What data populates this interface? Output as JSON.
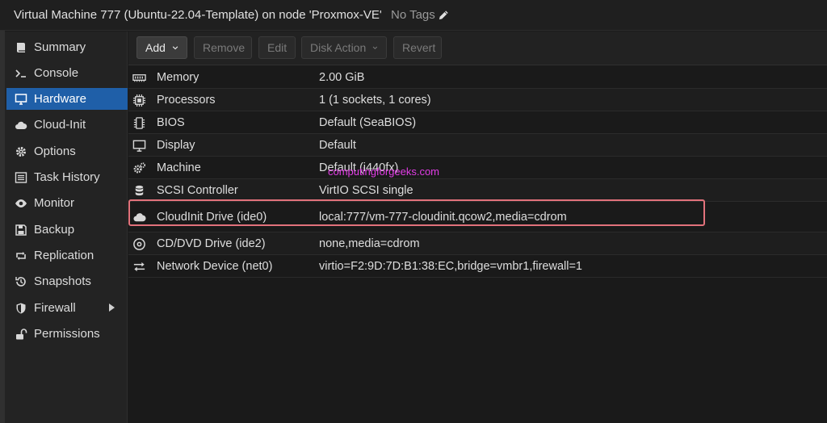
{
  "header": {
    "title": "Virtual Machine 777 (Ubuntu-22.04-Template) on node 'Proxmox-VE'",
    "tags_label": "No Tags",
    "tags_icon": "pencil-icon"
  },
  "sidebar": {
    "items": [
      {
        "label": "Summary",
        "icon": "book-icon",
        "active": false
      },
      {
        "label": "Console",
        "icon": "terminal-icon",
        "active": false
      },
      {
        "label": "Hardware",
        "icon": "desktop-icon",
        "active": true
      },
      {
        "label": "Cloud-Init",
        "icon": "cloud-icon",
        "active": false
      },
      {
        "label": "Options",
        "icon": "gear-icon",
        "active": false
      },
      {
        "label": "Task History",
        "icon": "list-icon",
        "active": false
      },
      {
        "label": "Monitor",
        "icon": "eye-icon",
        "active": false
      },
      {
        "label": "Backup",
        "icon": "floppy-icon",
        "active": false
      },
      {
        "label": "Replication",
        "icon": "retweet-icon",
        "active": false
      },
      {
        "label": "Snapshots",
        "icon": "history-icon",
        "active": false
      },
      {
        "label": "Firewall",
        "icon": "shield-icon",
        "active": false,
        "expandable": true
      },
      {
        "label": "Permissions",
        "icon": "unlock-icon",
        "active": false
      }
    ]
  },
  "toolbar": {
    "add": "Add",
    "remove": "Remove",
    "edit": "Edit",
    "disk_action": "Disk Action",
    "revert": "Revert"
  },
  "hardware": {
    "rows": [
      {
        "name": "Memory",
        "value": "2.00 GiB",
        "icon": "memory-icon"
      },
      {
        "name": "Processors",
        "value": "1 (1 sockets, 1 cores)",
        "icon": "cpu-icon"
      },
      {
        "name": "BIOS",
        "value": "Default (SeaBIOS)",
        "icon": "microchip-icon"
      },
      {
        "name": "Display",
        "value": "Default",
        "icon": "desktop-icon"
      },
      {
        "name": "Machine",
        "value": "Default (i440fx)",
        "icon": "cogs-icon"
      },
      {
        "name": "SCSI Controller",
        "value": "VirtIO SCSI single",
        "icon": "database-icon"
      },
      {
        "name": "CloudInit Drive (ide0)",
        "value": "local:777/vm-777-cloudinit.qcow2,media=cdrom",
        "icon": "cloud-icon",
        "highlighted": true
      },
      {
        "name": "CD/DVD Drive (ide2)",
        "value": "none,media=cdrom",
        "icon": "disc-icon"
      },
      {
        "name": "Network Device (net0)",
        "value": "virtio=F2:9D:7D:B1:38:EC,bridge=vmbr1,firewall=1",
        "icon": "exchange-icon"
      }
    ]
  },
  "watermark": "computingforgeeks.com",
  "colors": {
    "active_nav": "#1f5fa8",
    "highlight_border": "#e2727b",
    "watermark": "#e23ce6"
  }
}
